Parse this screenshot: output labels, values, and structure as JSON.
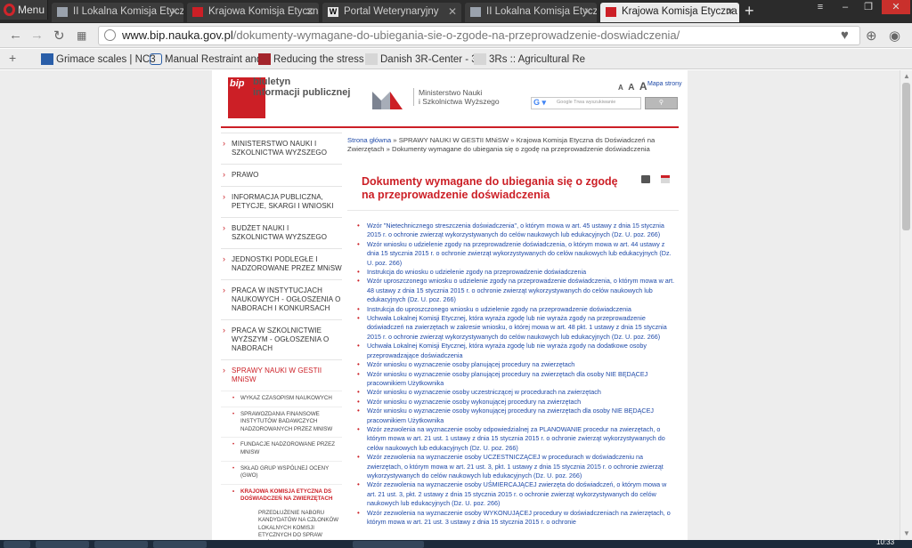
{
  "browser": {
    "menu_label": "Menu",
    "tabs": [
      {
        "label": "II Lokalna Komisja Etyczna",
        "active": false
      },
      {
        "label": "Krajowa Komisja Etyczna ds",
        "active": false
      },
      {
        "label": "Portal Weterynaryjny",
        "active": false
      },
      {
        "label": "II Lokalna Komisja Etyczna",
        "active": false
      },
      {
        "label": "Krajowa Komisja Etyczna",
        "active": true
      }
    ],
    "new_tab": "+",
    "url_host": "www.bip.nauka.gov.pl",
    "url_path": "/dokumenty-wymagane-do-ubiegania-sie-o-zgode-na-przeprowadzenie-doswiadczenia/",
    "bookmarks": [
      "Grimace scales | NC3",
      "Manual Restraint and",
      "Reducing the stress o",
      "Danish 3R-Center - 3",
      "3Rs :: Agricultural Re"
    ],
    "clock": "10:33"
  },
  "header": {
    "bip_logo": "bip",
    "bip_line1": "biuletyn",
    "bip_line2": "informacji publicznej",
    "ministry_line1": "Ministerstwo Nauki",
    "ministry_line2": "i Szkolnictwa Wyższego",
    "font_small": "A",
    "font_medium": "A",
    "font_large": "A",
    "site_map": "Mapa strony",
    "search_placeholder": "Google  Trwa wyszukiwanie",
    "search_button": "⚲"
  },
  "nav": {
    "items": [
      {
        "label": "MINISTERSTWO NAUKI I SZKOLNICTWA WYŻSZEGO"
      },
      {
        "label": "PRAWO"
      },
      {
        "label": "INFORMACJA PUBLICZNA, PETYCJE, SKARGI I WNIOSKI"
      },
      {
        "label": "BUDŻET NAUKI I SZKOLNICTWA WYŻSZEGO"
      },
      {
        "label": "JEDNOSTKI PODLEGŁE I NADZOROWANE PRZEZ MNiSW"
      },
      {
        "label": "PRACA W INSTYTUCJACH NAUKOWYCH - OGŁOSZENIA O NABORACH I KONKURSACH"
      },
      {
        "label": "PRACA W SZKOLNICTWIE WYŻSZYM - OGŁOSZENIA O NABORACH"
      },
      {
        "label": "SPRAWY NAUKI W GESTII MNiSW"
      }
    ],
    "subitems": [
      {
        "label": "WYKAZ CZASOPISM NAUKOWYCH"
      },
      {
        "label": "SPRAWOZDANIA FINANSOWE INSTYTUTÓW BADAWCZYCH NADZOROWANYCH PRZEZ MNISW"
      },
      {
        "label": "FUNDACJE NADZOROWANE PRZEZ MNISW"
      },
      {
        "label": "SKŁAD GRUP WSPÓLNEJ OCENY (GWO)"
      },
      {
        "label": "KRAJOWA KOMISJA ETYCZNA DS DOŚWIADCZEŃ NA ZWIERZĘTACH"
      }
    ],
    "subsub": "PRZEDŁUŻENIE NABORU KANDYDATÓW NA CZŁONKÓW LOKALNYCH KOMISJI ETYCZNYCH DO SPRAW DOŚWIADCZEŃ NA"
  },
  "breadcrumb": {
    "home": "Strona główna",
    "sep": " » ",
    "l1": "SPRAWY NAUKI W GESTII MNiSW",
    "l2": "Krajowa Komisja Etyczna ds Doświadczeń na Zwierzętach",
    "current": "Dokumenty wymagane do ubiegania się o zgodę na przeprowadzenie doświadczenia"
  },
  "page_title": "Dokumenty wymagane do ubiegania się o zgodę na przeprowadzenie doświadczenia",
  "documents": [
    "Wzór \"Nietechnicznego streszczenia doświadczenia\", o którym mowa w art. 45 ustawy z dnia 15 stycznia 2015 r. o ochronie zwierząt wykorzystywanych do celów naukowych lub edukacyjnych (Dz. U. poz. 266)",
    "Wzór wniosku o udzielenie zgody na przeprowadzenie doświadczenia, o którym mowa w art. 44 ustawy z dnia 15 stycznia 2015 r. o ochronie zwierząt wykorzystywanych do celów naukowych lub edukacyjnych (Dz. U. poz. 266)",
    "Instrukcja do wniosku o udzielenie zgody na przeprowadzenie doświadczenia",
    "Wzór uproszczonego wniosku o udzielenie zgody na przeprowadzenie doświadczenia, o którym mowa w art. 48 ustawy z dnia 15 stycznia 2015 r. o ochronie zwierząt wykorzystywanych do celów naukowych lub edukacyjnych (Dz. U. poz. 266)",
    "Instrukcja do uproszczonego wniosku o udzielenie zgody na przeprowadzenie doświadczenia",
    "Uchwała Lokalnej Komisji Etycznej, która wyraża zgodę lub nie wyraża zgody na przeprowadzenie doświadczeń na zwierzętach w zakresie wniosku, o której mowa w art. 48 pkt. 1 ustawy z dnia 15 stycznia 2015 r. o ochronie zwierząt wykorzystywanych do celów naukowych lub edukacyjnych (Dz. U. poz. 266)",
    "Uchwała Lokalnej Komisji Etycznej, która wyraża zgodę lub nie wyraża zgody na dodatkowe osoby przeprowadzające doświadczenia",
    "Wzór wniosku o wyznaczenie osoby planującej procedury na zwierzętach",
    "Wzór wniosku o wyznaczenie osoby planującej procedury na zwierzętach dla osoby NIE BĘDĄCEJ pracownikiem Użytkownika",
    "Wzór wniosku o wyznaczenie osoby uczestniczącej w procedurach na zwierzętach",
    "Wzór wniosku o wyznaczenie osoby wykonującej procedury na zwierzętach",
    "Wzór wniosku o wyznaczenie osoby wykonującej procedury na zwierzętach dla osoby NIE BĘDĄCEJ pracownikiem Użytkownika",
    "Wzór zezwolenia na wyznaczenie osoby odpowiedzialnej za PLANOWANIE procedur na zwierzętach, o którym mowa w art. 21 ust. 1 ustawy z dnia 15 stycznia 2015 r. o ochronie zwierząt wykorzystywanych do celów naukowych lub edukacyjnych (Dz. U. poz. 266)",
    "Wzór zezwolenia na wyznaczenie osoby UCZESTNICZĄCEJ w procedurach w doświadczeniu na zwierzętach, o którym mowa w art. 21 ust. 3, pkt. 1 ustawy z dnia 15 stycznia 2015 r. o ochronie zwierząt wykorzystywanych do celów naukowych lub edukacyjnych (Dz. U. poz. 266)",
    "Wzór zezwolenia na wyznaczenie osoby UŚMIERCAJĄCEJ zwierzęta do doświadczeń, o którym mowa w art. 21 ust. 3, pkt. 2 ustawy z dnia 15 stycznia 2015 r. o ochronie zwierząt wykorzystywanych do celów naukowych lub edukacyjnych (Dz. U. poz. 266)",
    "Wzór zezwolenia na wyznaczenie osoby WYKONUJĄCEJ procedury w doświadczeniach na zwierzętach, o którym mowa w art. 21 ust. 3 ustawy z dnia 15 stycznia 2015 r. o ochronie"
  ],
  "colors": {
    "accent": "#cc1f26",
    "link": "#1f4aa8"
  }
}
